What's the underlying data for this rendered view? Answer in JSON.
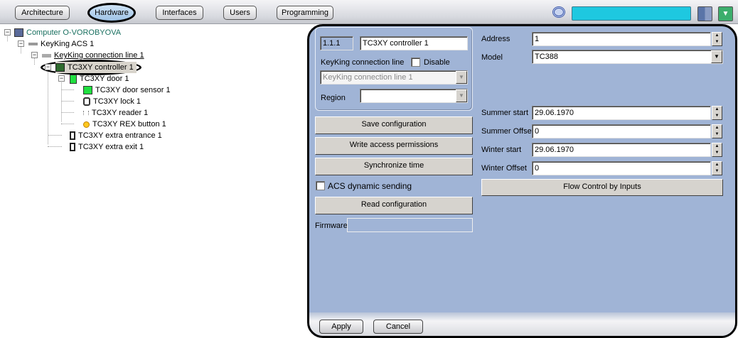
{
  "tabs": [
    {
      "label": "Architecture"
    },
    {
      "label": "Hardware",
      "active": true
    },
    {
      "label": "Interfaces"
    },
    {
      "label": "Users"
    },
    {
      "label": "Programming"
    }
  ],
  "toolbar": {
    "logo_icon": "spiral-logo-icon",
    "layout_icon": "grid-layout-icon",
    "menu_icon": "dropdown-arrow-icon",
    "accent": "#1ec8e0"
  },
  "tree": [
    {
      "label": "Computer O-VOROBYOVA",
      "icon": "computer-icon"
    },
    {
      "label": "KeyKing ACS 1",
      "icon": "acs-icon"
    },
    {
      "label": "KeyKing connection line 1",
      "icon": "connection-line-icon"
    },
    {
      "label": "TC3XY controller 1",
      "icon": "controller-icon",
      "selected": true
    },
    {
      "label": "TC3XY door 1",
      "icon": "door-icon"
    },
    {
      "label": "TC3XY door sensor 1",
      "icon": "door-sensor-icon"
    },
    {
      "label": "TC3XY lock 1",
      "icon": "lock-icon"
    },
    {
      "label": "TC3XY reader 1",
      "icon": "reader-icon"
    },
    {
      "label": "TC3XY REX button 1",
      "icon": "rex-button-icon"
    },
    {
      "label": "TC3XY extra entrance 1",
      "icon": "entrance-icon"
    },
    {
      "label": "TC3XY extra exit 1",
      "icon": "exit-icon"
    }
  ],
  "panel": {
    "id": "1.1.1",
    "name": "TC3XY controller 1",
    "connection_label": "KeyKing connection line",
    "disable_label": "Disable",
    "connection_value": "KeyKing connection line 1",
    "region_label": "Region",
    "region_value": "",
    "save": "Save configuration",
    "write": "Write access permissions",
    "sync": "Synchronize time",
    "acs_dynamic": "ACS dynamic sending",
    "read": "Read configuration",
    "firmware_label": "Firmware",
    "firmware_value": "",
    "address_label": "Address",
    "address": "1",
    "model_label": "Model",
    "model": "TC388",
    "summer_start_label": "Summer start",
    "summer_start": "29.06.1970",
    "summer_offset_label": "Summer Offset",
    "summer_offset": "0",
    "winter_start_label": "Winter start",
    "winter_start": "29.06.1970",
    "winter_offset_label": "Winter Offset",
    "winter_offset": "0",
    "flow": "Flow Control by Inputs",
    "apply": "Apply",
    "cancel": "Cancel"
  }
}
